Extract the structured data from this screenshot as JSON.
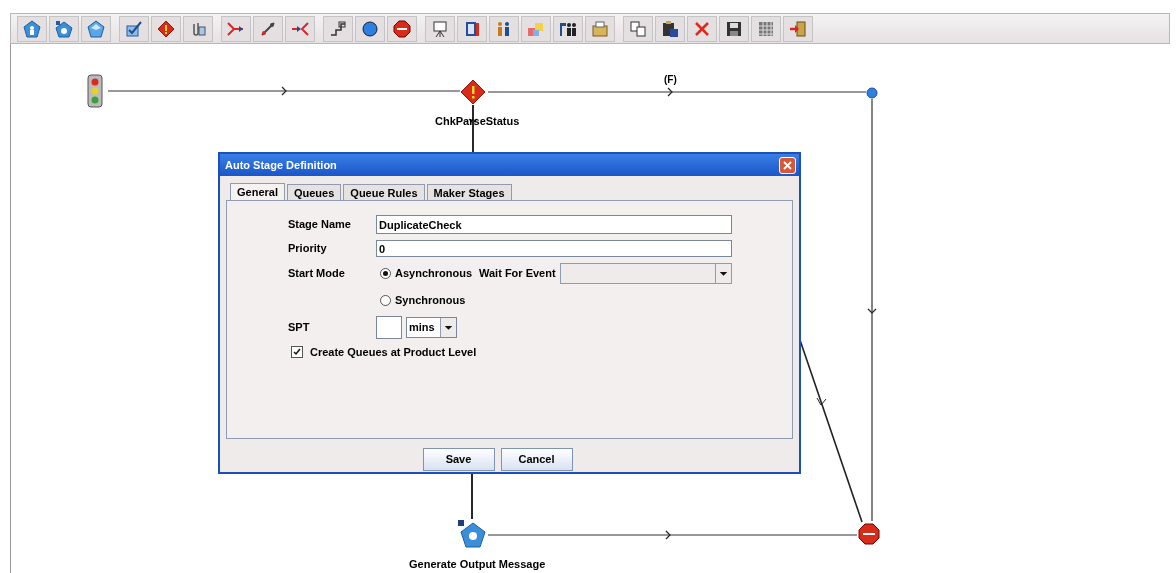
{
  "diagram": {
    "nodes": [
      {
        "kind": "start"
      },
      {
        "kind": "decision",
        "label": "ChkParseStatus"
      },
      {
        "kind": "junction"
      },
      {
        "kind": "task",
        "label": "Generate Output Message"
      },
      {
        "kind": "stop"
      }
    ],
    "edge_labels": [
      "(F)"
    ]
  },
  "dialog": {
    "title": "Auto Stage Definition",
    "tabs": [
      {
        "label": "General",
        "selected": true
      },
      {
        "label": "Queues",
        "selected": false
      },
      {
        "label": "Queue Rules",
        "selected": false
      },
      {
        "label": "Maker Stages",
        "selected": false
      }
    ],
    "stage_name": {
      "label": "Stage Name",
      "value": "DuplicateCheck"
    },
    "priority": {
      "label": "Priority",
      "value": "0"
    },
    "start_mode": {
      "label": "Start Mode",
      "options": [
        {
          "label": "Asynchronous",
          "selected": true
        },
        {
          "label": "Synchronous",
          "selected": false
        }
      ],
      "wait_for_event": {
        "label": "Wait For Event"
      }
    },
    "spt": {
      "label": "SPT",
      "unit": "mins"
    },
    "create_queues": {
      "label": "Create Queues at Product Level",
      "checked": true
    },
    "buttons": [
      "Save",
      "Cancel"
    ]
  }
}
